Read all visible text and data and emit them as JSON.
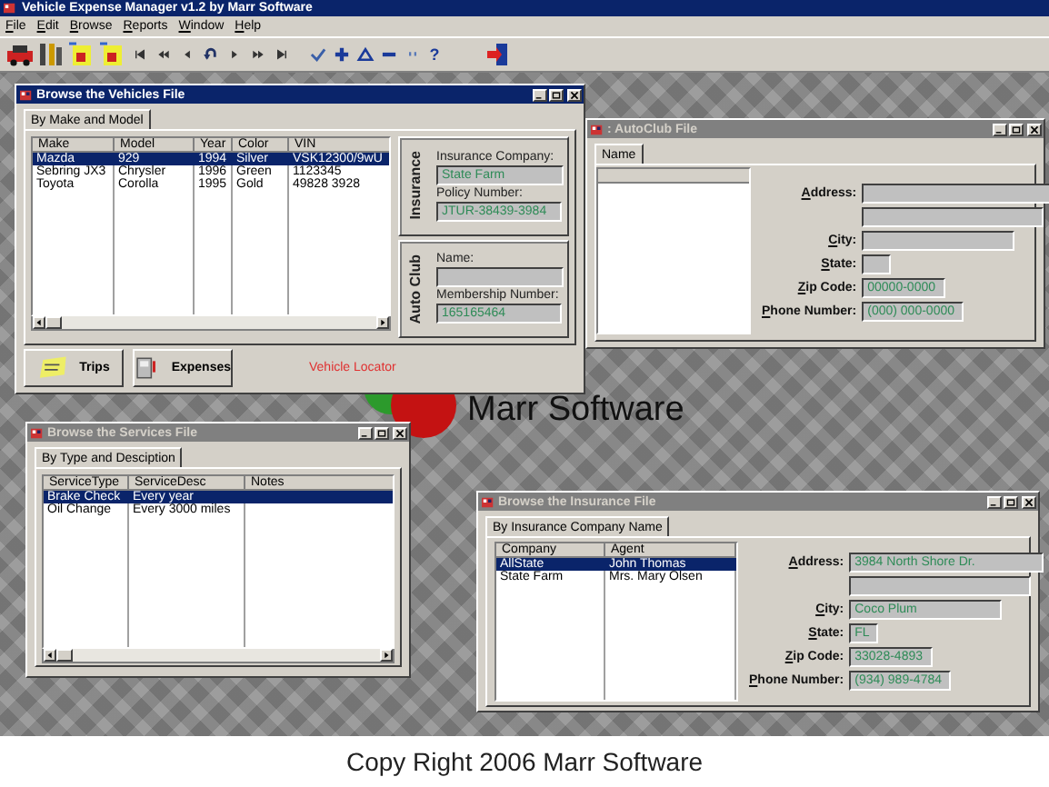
{
  "window": {
    "title": "Vehicle Expense Manager v1.2 by Marr Software"
  },
  "menu": [
    "File",
    "Edit",
    "Browse",
    "Reports",
    "Window",
    "Help"
  ],
  "toolbar_help": "?",
  "vehicles_window": {
    "title": "Browse the Vehicles File",
    "active": true,
    "tabs": [
      {
        "label": "By Make and Model",
        "selected": true
      }
    ],
    "columns": [
      "Make",
      "Model",
      "Year",
      "Color",
      "VIN"
    ],
    "rows": [
      {
        "cells": [
          "Mazda",
          "929",
          "1994",
          "Silver",
          "VSK12300/9wU"
        ],
        "selected": true
      },
      {
        "cells": [
          "Sebring JX3",
          "Chrysler",
          "1996",
          "Green",
          "1123345"
        ],
        "selected": false
      },
      {
        "cells": [
          "Toyota",
          "Corolla",
          "1995",
          "Gold",
          "49828 3928"
        ],
        "selected": false
      }
    ],
    "insurance": {
      "heading": "Insurance",
      "fields": [
        {
          "label": "Insurance Company:",
          "value": "State Farm"
        },
        {
          "label": "Policy Number:",
          "value": "JTUR-38439-3984"
        }
      ]
    },
    "auto_club": {
      "heading": "Auto Club",
      "fields": [
        {
          "label": "Name:"
        },
        {
          "label": "Membership Number:",
          "value": "165165464"
        }
      ]
    },
    "buttons": [
      {
        "label": "Trips",
        "kind": "trips"
      },
      {
        "label": "Expenses",
        "kind": "expenses"
      }
    ],
    "locator": "Vehicle Locator"
  },
  "autoclub_window": {
    "title": ": AutoClub File",
    "active": false,
    "tabs": [
      {
        "label": "Name",
        "selected": true
      }
    ],
    "fields": [
      {
        "kind": "address",
        "label": "Address:"
      },
      {
        "kind": "address2"
      },
      {
        "kind": "city",
        "label": "City:"
      },
      {
        "kind": "state",
        "label": "State:"
      },
      {
        "kind": "zip",
        "label": "Zip Code:",
        "value": "00000-0000"
      },
      {
        "kind": "phone",
        "label": "Phone Number:",
        "value": "(000) 000-0000"
      }
    ]
  },
  "logo": {
    "name": "Marr Software"
  },
  "services_window": {
    "title": "Browse the Services File",
    "active": false,
    "tabs": [
      {
        "label": "By Type and Desciption",
        "selected": true
      }
    ],
    "columns": [
      "ServiceType",
      "ServiceDesc",
      "Notes"
    ],
    "rows": [
      {
        "cells": [
          "Brake Check",
          "Every year"
        ],
        "selected": true
      },
      {
        "cells": [
          "Oil Change",
          "Every 3000 miles"
        ],
        "selected": false
      }
    ]
  },
  "insurance_window": {
    "title": "Browse the Insurance File",
    "active": false,
    "tabs": [
      {
        "label": "By Insurance Company Name",
        "selected": true
      }
    ],
    "columns": [
      "Company",
      "Agent"
    ],
    "rows": [
      {
        "cells": [
          "AllState",
          "John Thomas"
        ],
        "selected": true
      },
      {
        "cells": [
          "State Farm",
          "Mrs. Mary Olsen"
        ],
        "selected": false
      }
    ],
    "fields": [
      {
        "kind": "address",
        "label": "Address:",
        "value": "3984 North Shore Dr."
      },
      {
        "kind": "address2"
      },
      {
        "kind": "city",
        "label": "City:",
        "value": "Coco Plum"
      },
      {
        "kind": "state",
        "label": "State:",
        "value": "FL"
      },
      {
        "kind": "zip",
        "label": "Zip Code:",
        "value": "33028-4893"
      },
      {
        "kind": "phone",
        "label": "Phone Number:",
        "value": "(934) 989-4784"
      }
    ]
  },
  "caption": "Copy Right 2006 Marr Software"
}
